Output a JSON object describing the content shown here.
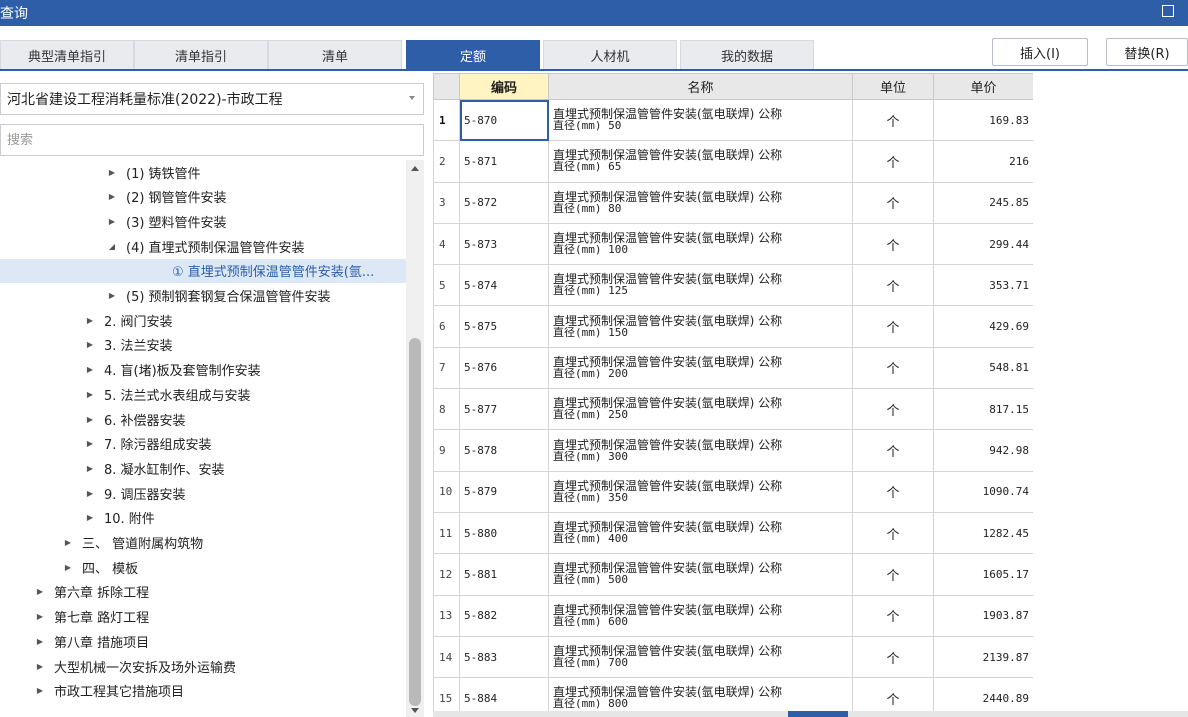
{
  "window": {
    "title": "查询"
  },
  "tabs": [
    {
      "label": "典型清单指引",
      "active": false
    },
    {
      "label": "清单指引",
      "active": false
    },
    {
      "label": "清单",
      "active": false
    },
    {
      "label": "定额",
      "active": true
    },
    {
      "label": "人材机",
      "active": false
    },
    {
      "label": "我的数据",
      "active": false
    }
  ],
  "actions": {
    "insert": "插入(I)",
    "replace": "替换(R)"
  },
  "library": {
    "selected": "河北省建设工程消耗量标准(2022)-市政工程"
  },
  "search": {
    "placeholder": "搜索",
    "value": ""
  },
  "tree": [
    {
      "label": "(1) 铸铁管件",
      "state": "collapsed"
    },
    {
      "label": "(2) 钢管管件安装",
      "state": "collapsed"
    },
    {
      "label": "(3) 塑料管件安装",
      "state": "collapsed"
    },
    {
      "label": "(4) 直埋式预制保温管管件安装",
      "state": "expanded"
    },
    {
      "label": "① 直埋式预制保温管管件安装(氩...",
      "state": "leaf",
      "selected": true
    },
    {
      "label": "(5) 预制钢套钢复合保温管管件安装",
      "state": "collapsed"
    },
    {
      "label": "2. 阀门安装",
      "state": "collapsed"
    },
    {
      "label": "3. 法兰安装",
      "state": "collapsed"
    },
    {
      "label": "4. 盲(堵)板及套管制作安装",
      "state": "collapsed"
    },
    {
      "label": "5. 法兰式水表组成与安装",
      "state": "collapsed"
    },
    {
      "label": "6. 补偿器安装",
      "state": "collapsed"
    },
    {
      "label": "7. 除污器组成安装",
      "state": "collapsed"
    },
    {
      "label": "8. 凝水缸制作、安装",
      "state": "collapsed"
    },
    {
      "label": "9. 调压器安装",
      "state": "collapsed"
    },
    {
      "label": "10. 附件",
      "state": "collapsed"
    },
    {
      "label": "三、 管道附属构筑物",
      "state": "collapsed"
    },
    {
      "label": "四、 模板",
      "state": "collapsed"
    },
    {
      "label": "第六章 拆除工程",
      "state": "collapsed"
    },
    {
      "label": "第七章 路灯工程",
      "state": "collapsed"
    },
    {
      "label": "第八章 措施项目",
      "state": "collapsed"
    },
    {
      "label": "大型机械一次安拆及场外运输费",
      "state": "collapsed"
    },
    {
      "label": "市政工程其它措施项目",
      "state": "collapsed"
    }
  ],
  "table": {
    "headers": {
      "code": "编码",
      "name": "名称",
      "unit": "单位",
      "price": "单价"
    },
    "rows": [
      {
        "no": "1",
        "code": "5-870",
        "name1": "直埋式预制保温管管件安装(氩电联焊) 公称",
        "name2": "直径(mm) 50",
        "unit": "个",
        "price": "169.83"
      },
      {
        "no": "2",
        "code": "5-871",
        "name1": "直埋式预制保温管管件安装(氩电联焊) 公称",
        "name2": "直径(mm) 65",
        "unit": "个",
        "price": "216"
      },
      {
        "no": "3",
        "code": "5-872",
        "name1": "直埋式预制保温管管件安装(氩电联焊) 公称",
        "name2": "直径(mm) 80",
        "unit": "个",
        "price": "245.85"
      },
      {
        "no": "4",
        "code": "5-873",
        "name1": "直埋式预制保温管管件安装(氩电联焊) 公称",
        "name2": "直径(mm) 100",
        "unit": "个",
        "price": "299.44"
      },
      {
        "no": "5",
        "code": "5-874",
        "name1": "直埋式预制保温管管件安装(氩电联焊) 公称",
        "name2": "直径(mm) 125",
        "unit": "个",
        "price": "353.71"
      },
      {
        "no": "6",
        "code": "5-875",
        "name1": "直埋式预制保温管管件安装(氩电联焊) 公称",
        "name2": "直径(mm) 150",
        "unit": "个",
        "price": "429.69"
      },
      {
        "no": "7",
        "code": "5-876",
        "name1": "直埋式预制保温管管件安装(氩电联焊) 公称",
        "name2": "直径(mm) 200",
        "unit": "个",
        "price": "548.81"
      },
      {
        "no": "8",
        "code": "5-877",
        "name1": "直埋式预制保温管管件安装(氩电联焊) 公称",
        "name2": "直径(mm) 250",
        "unit": "个",
        "price": "817.15"
      },
      {
        "no": "9",
        "code": "5-878",
        "name1": "直埋式预制保温管管件安装(氩电联焊) 公称",
        "name2": "直径(mm) 300",
        "unit": "个",
        "price": "942.98"
      },
      {
        "no": "10",
        "code": "5-879",
        "name1": "直埋式预制保温管管件安装(氩电联焊) 公称",
        "name2": "直径(mm) 350",
        "unit": "个",
        "price": "1090.74"
      },
      {
        "no": "11",
        "code": "5-880",
        "name1": "直埋式预制保温管管件安装(氩电联焊) 公称",
        "name2": "直径(mm) 400",
        "unit": "个",
        "price": "1282.45"
      },
      {
        "no": "12",
        "code": "5-881",
        "name1": "直埋式预制保温管管件安装(氩电联焊) 公称",
        "name2": "直径(mm) 500",
        "unit": "个",
        "price": "1605.17"
      },
      {
        "no": "13",
        "code": "5-882",
        "name1": "直埋式预制保温管管件安装(氩电联焊) 公称",
        "name2": "直径(mm) 600",
        "unit": "个",
        "price": "1903.87"
      },
      {
        "no": "14",
        "code": "5-883",
        "name1": "直埋式预制保温管管件安装(氩电联焊) 公称",
        "name2": "直径(mm) 700",
        "unit": "个",
        "price": "2139.87"
      },
      {
        "no": "15",
        "code": "5-884",
        "name1": "直埋式预制保温管管件安装(氩电联焊) 公称",
        "name2": "直径(mm) 800",
        "unit": "个",
        "price": "2440.89"
      }
    ]
  },
  "colors": {
    "accent": "#2e5ea8",
    "selected_row": "#dde8f7",
    "code_header": "#fff4c2"
  },
  "icons": {
    "maximize": "maximize-icon",
    "dropdown": "chevron-down-icon",
    "tree_collapsed": "caret-right-icon",
    "tree_expanded": "caret-down-icon"
  }
}
